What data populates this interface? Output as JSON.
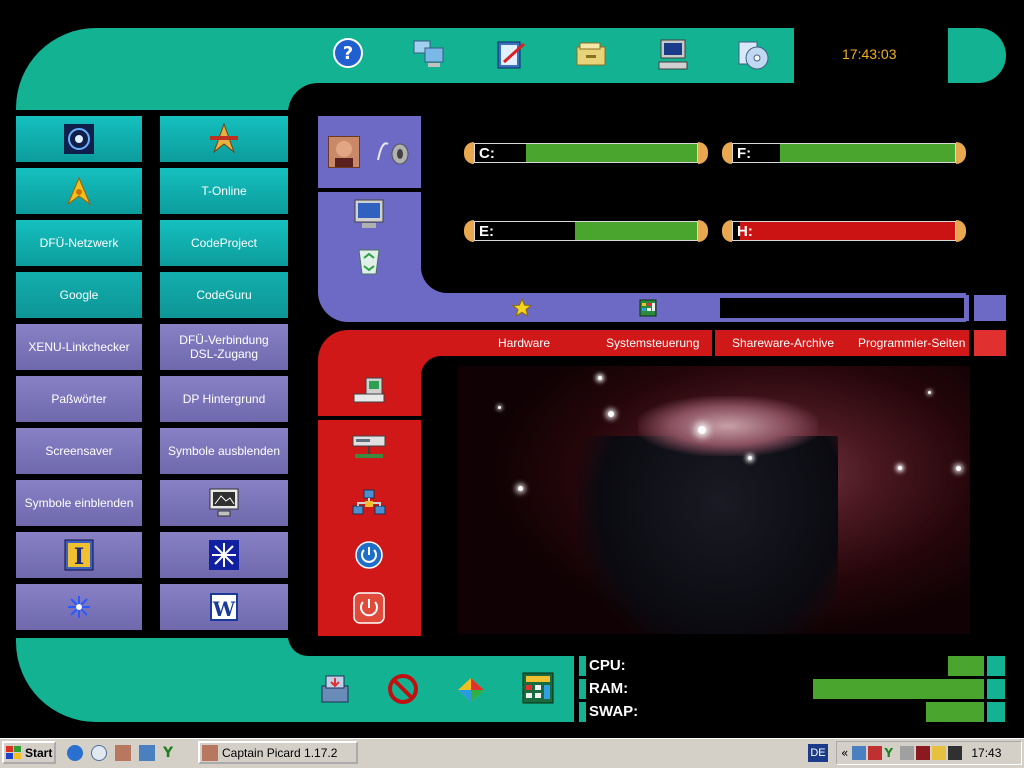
{
  "clock": "17:43:03",
  "top_icons": [
    "help-icon",
    "network-computers-icon",
    "edit-document-icon",
    "file-cabinet-icon",
    "computer-terminal-icon",
    "cd-software-icon"
  ],
  "left_buttons": [
    {
      "label": "",
      "icon": "galaxy-icon",
      "style": "teal"
    },
    {
      "label": "",
      "icon": "starfleet-insignia-icon",
      "style": "teal"
    },
    {
      "label": "",
      "icon": "starfleet-delta-icon",
      "style": "teal"
    },
    {
      "label": "T-Online",
      "style": "teal"
    },
    {
      "label": "DFÜ-Netzwerk",
      "style": "teal"
    },
    {
      "label": "CodeProject",
      "style": "teal"
    },
    {
      "label": "Google",
      "style": "teal2"
    },
    {
      "label": "CodeGuru",
      "style": "teal2"
    },
    {
      "label": "XENU-Linkchecker",
      "style": "lav"
    },
    {
      "label": "DFÜ-Verbindung\nDSL-Zugang",
      "style": "lav"
    },
    {
      "label": "Paßwörter",
      "style": "lav"
    },
    {
      "label": "DP Hintergrund",
      "style": "lav"
    },
    {
      "label": "Screensaver",
      "style": "lav"
    },
    {
      "label": "Symbole ausblenden",
      "style": "lav"
    },
    {
      "label": "Symbole einblenden",
      "style": "lav"
    },
    {
      "label": "",
      "icon": "display-properties-icon",
      "style": "lav"
    },
    {
      "label": "",
      "icon": "infobar-icon",
      "style": "lav"
    },
    {
      "label": "",
      "icon": "starburst-icon",
      "style": "lav"
    },
    {
      "label": "",
      "icon": "sparkle-icon",
      "style": "lav"
    },
    {
      "label": "",
      "icon": "word-icon",
      "style": "lav"
    }
  ],
  "drives": [
    {
      "label": "C:",
      "used": 0.77,
      "color": "#4aa52e"
    },
    {
      "label": "F:",
      "used": 0.79,
      "color": "#4aa52e"
    },
    {
      "label": "E:",
      "used": 0.55,
      "color": "#4aa52e"
    },
    {
      "label": "H:",
      "used": 0.97,
      "color": "#cc1313"
    }
  ],
  "tabs": [
    "Hardware",
    "Systemsteuerung",
    "Shareware-Archive",
    "Programmier-Seiten"
  ],
  "stats": {
    "cpu_label": "CPU:",
    "ram_label": "RAM:",
    "swap_label": "SWAP:",
    "cpu": 0.2,
    "ram": 0.95,
    "swap": 0.32
  },
  "bottom_icons": [
    "install-icon",
    "no-entry-icon",
    "puzzle-icon",
    "calculator-icon"
  ],
  "taskbar": {
    "start": "Start",
    "task": "Captain Picard 1.17.2",
    "lang": "DE",
    "time": "17:43"
  },
  "colors": {
    "teal": "#12b293",
    "lavender": "#6d6ac6",
    "red": "#d01818",
    "bar_green": "#4aa52e",
    "bar_red": "#cc1313",
    "clock": "#f0b020"
  }
}
